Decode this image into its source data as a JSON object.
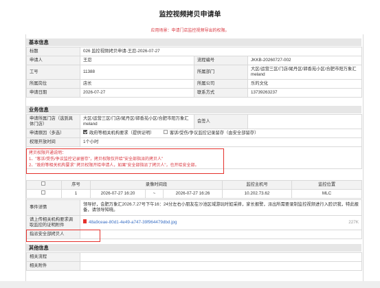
{
  "header": {
    "title": "监控视频拷贝申请单",
    "subtitle": "应用场景：申请门店监控视频导出的权限。"
  },
  "basic_info": {
    "section_title": "基本信息",
    "rows": [
      {
        "label": "标题",
        "value": "026 监控视频拷贝申请-王忍-2026-07-27"
      },
      {
        "label": "申请人",
        "value": "王忍",
        "label2": "流程编号",
        "value2": "JKKB-20260727-002"
      },
      {
        "label": "工号",
        "value": "11388",
        "label2": "所属部门",
        "value2": "大区/运营三区/门店/尾丹区/郭香苑小区/合肥市阳万象汇meland"
      },
      {
        "label": "所属岗位",
        "value": "店长",
        "label2": "所属公司",
        "value2": "乐的文化"
      },
      {
        "label": "申请日期",
        "value": "2026-07-27",
        "label2": "联系方式",
        "value2": "13739263237"
      }
    ]
  },
  "business_info": {
    "section_title": "业务信息",
    "store_label": "申请所属门店（选到具体门店）",
    "store_value": "大区/运营三区/门店/尾丹区/郭香苑小区/合肥市阳万象汇meland",
    "signer_label": "会签人",
    "scene_label": "申请原因（多选）",
    "scene_options": [
      {
        "label": "政府等相关机构要求（提供证明）",
        "checked": true
      },
      {
        "label": "客诉/受伤/争议监控记录留存（由安全部留存）",
        "checked": false
      }
    ],
    "window_label": "权限开放时间",
    "window_value": "1个小时",
    "note_lines": [
      "拷贝权限开通说明：",
      "1、\"客诉/受伤/争议监控记录留存\"，拷贝权限仅开给\"安全部指派的拷贝人\"",
      "2、\"政府等相关机构要求\" 拷贝权限开给申请人，如果\"安全部指派了拷贝人\"，也开给安全部。"
    ],
    "table": {
      "headers": [
        "",
        "序号",
        "录像时间段",
        "",
        "",
        "监控主机号",
        "监控位置"
      ],
      "rows": [
        {
          "index": "1",
          "start": "2026-07-27 16:20",
          "sep": "~",
          "end": "2026-07-27 16:26",
          "host": "10.202.73.62",
          "location": "MLC"
        }
      ]
    },
    "detail_label": "事件详情",
    "detail_value": "领导好，会肥万象汇2026.7.27号下午16：24分左右小朋友在沙池区域游玩时如采摔，家长报警，派出所需要录制监控视频进行入脸识我，特此报备，请领导知晓。",
    "attach_label": "请上传相关机构要求调取监控的证明附件",
    "attach_file": "48a9ceae-80d1-4e49-a747-39f964479dbd.jpg",
    "attach_size": "227K",
    "copier_label": "指派安全部拷贝人",
    "copier_value": ""
  },
  "other_info": {
    "section_title": "其他信息",
    "rows": [
      {
        "label": "相关流程",
        "value": ""
      },
      {
        "label": "相关附件",
        "value": ""
      }
    ]
  },
  "colors": {
    "accent_red": "#e5302b",
    "link_blue": "#3a6fc4",
    "label_bg": "#f2f2f2",
    "section_bg": "#e6e6e6"
  }
}
